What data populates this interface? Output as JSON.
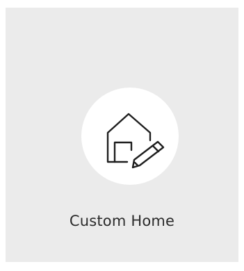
{
  "tile": {
    "label": "Custom Home",
    "icon": "house-edit-icon",
    "background_color": "#ebebeb",
    "circle_color": "#ffffff"
  }
}
